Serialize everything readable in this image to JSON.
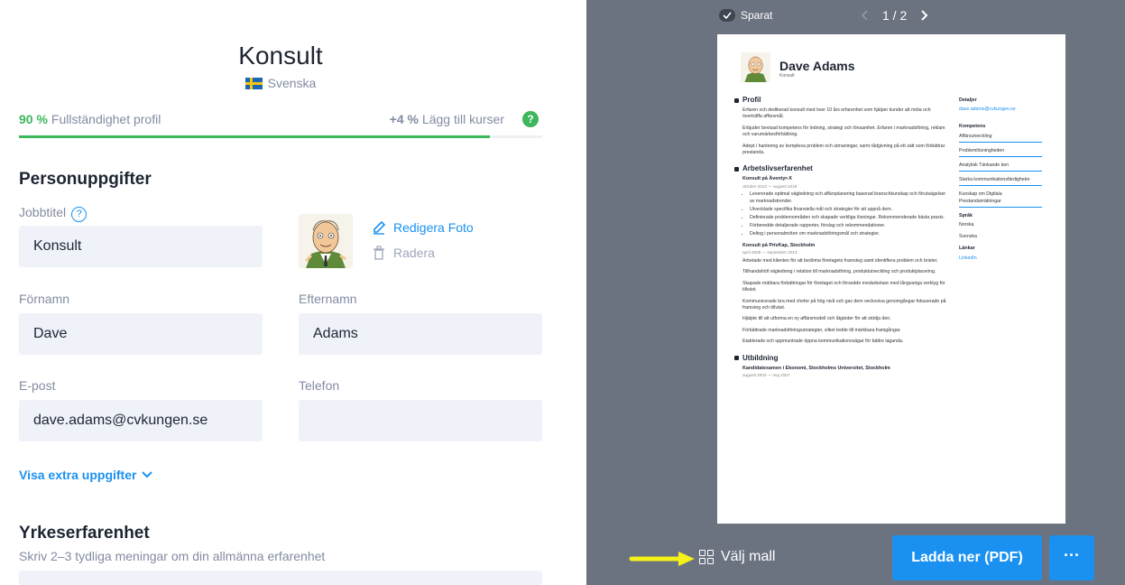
{
  "editor": {
    "title": "Konsult",
    "language": "Svenska",
    "progress": {
      "percent_label": "90 %",
      "percent": 0.9,
      "label": "Fullständighet profil",
      "hint_value": "+4 %",
      "hint_label": "Lägg till kurser",
      "help_symbol": "?"
    },
    "personal": {
      "title": "Personuppgifter",
      "job_title_label": "Jobbtitel",
      "job_title_help": "?",
      "job_title_value": "Konsult",
      "edit_photo": "Redigera Foto",
      "delete_photo": "Radera",
      "first_name_label": "Förnamn",
      "first_name_value": "Dave",
      "last_name_label": "Efternamn",
      "last_name_value": "Adams",
      "email_label": "E-post",
      "email_value": "dave.adams@cvkungen.se",
      "phone_label": "Telefon",
      "phone_value": "",
      "extra_link": "Visa extra uppgifter"
    },
    "experience": {
      "title": "Yrkeserfarenhet",
      "subtitle": "Skriv 2–3 tydliga meningar om din allmänna erfarenhet"
    }
  },
  "preview": {
    "saved_label": "Sparat",
    "page_indicator": "1 / 2",
    "choose_template": "Välj mall",
    "download_label": "Ladda ner (PDF)",
    "more_label": "···",
    "cv": {
      "name": "Dave Adams",
      "subtitle": "Konsult",
      "profile_heading": "Profil",
      "profile": [
        "Erfaren och dedikerad konsult med över 10 års erfarenhet som hjälper kunder att möta och överträffa affärsmål.",
        "Erbjuder bevisad kompetens för ledning, strategi och lönsamhet. Erfaren i marknadsföring, reklam och varumärkesförbättring.",
        "Adept i hantering av komplexa problem och utmaningar, samt rådgivning på ett sätt som förbättrar prestanda."
      ],
      "work_heading": "Arbetslivserfarenhet",
      "job1_title": "Konsult på Äventyr-X",
      "job1_date": "oktober 2013 — augusti 2018",
      "job1_bullets": [
        "Levererade optimal vägledning och affärsplanering baserad branschkunskap och förutsägelser av marknadstrender.",
        "Utvecklade specifika finansiella mål och strategier för att uppnå dem.",
        "Definierade problemområden och skapade verkliga lösningar. Rekommenderade bästa praxis.",
        "Förberedde detaljerade rapporter, förslag och rekommendationer.",
        "Deltog i personalmöten om marknadsföringsmål och strategier."
      ],
      "job2_title": "Konsult på PrivKap, Stockholm",
      "job2_date": "april 2009 — september 2013",
      "job2_paragraphs": [
        "Arbetade med klienten för att bedöma företagets framsteg samt identifiera problem och brister.",
        "Tillhandahöll vägledning i relation till marknadsföring, produktutveckling och produktplacering.",
        "Skapade mätbara förbättringar för företaget och försedde medarbetare med långvariga verktyg för tillväxt.",
        "Kommunicerade bra med chefer på hög nivå och gav dem veckovisa genomgångar fokuserade på framsteg och tillväxt.",
        "Hjälpte till att utforma en ny affärsmodell och åtgärder för att stödja den.",
        "Förbättrade marknadsföringsstrategier, vilket ledde till märkbara framgångar.",
        "Etablerade och uppmuntrade öppna kommunikationsvägar för bättre laganda."
      ],
      "education_heading": "Utbildning",
      "edu_title": "Kandidatexamen i Ekonomi, Stockholms Universitet, Stockholm",
      "edu_date": "augusti 2003 — maj 2007",
      "details_heading": "Detaljer",
      "details_email": "dave.adams@cvkungen.se",
      "skills_heading": "Kompetens",
      "skills": [
        "Affärsutveckling",
        "Problemlösningheden",
        "Analytisk Tänkande ken",
        "Starka kommunikationsfärdigheter",
        "Kunskap om Digitala Prestandamätningar"
      ],
      "languages_heading": "Språk",
      "languages": [
        "Norska",
        "Svenska"
      ],
      "links_heading": "Länkar",
      "link": "LinkedIn"
    }
  },
  "colors": {
    "accent": "#1a91f0",
    "progress": "#3cb75b",
    "preview_bg": "#6b7380",
    "input_bg": "#eff2f9",
    "arrow": "#f5f219"
  }
}
